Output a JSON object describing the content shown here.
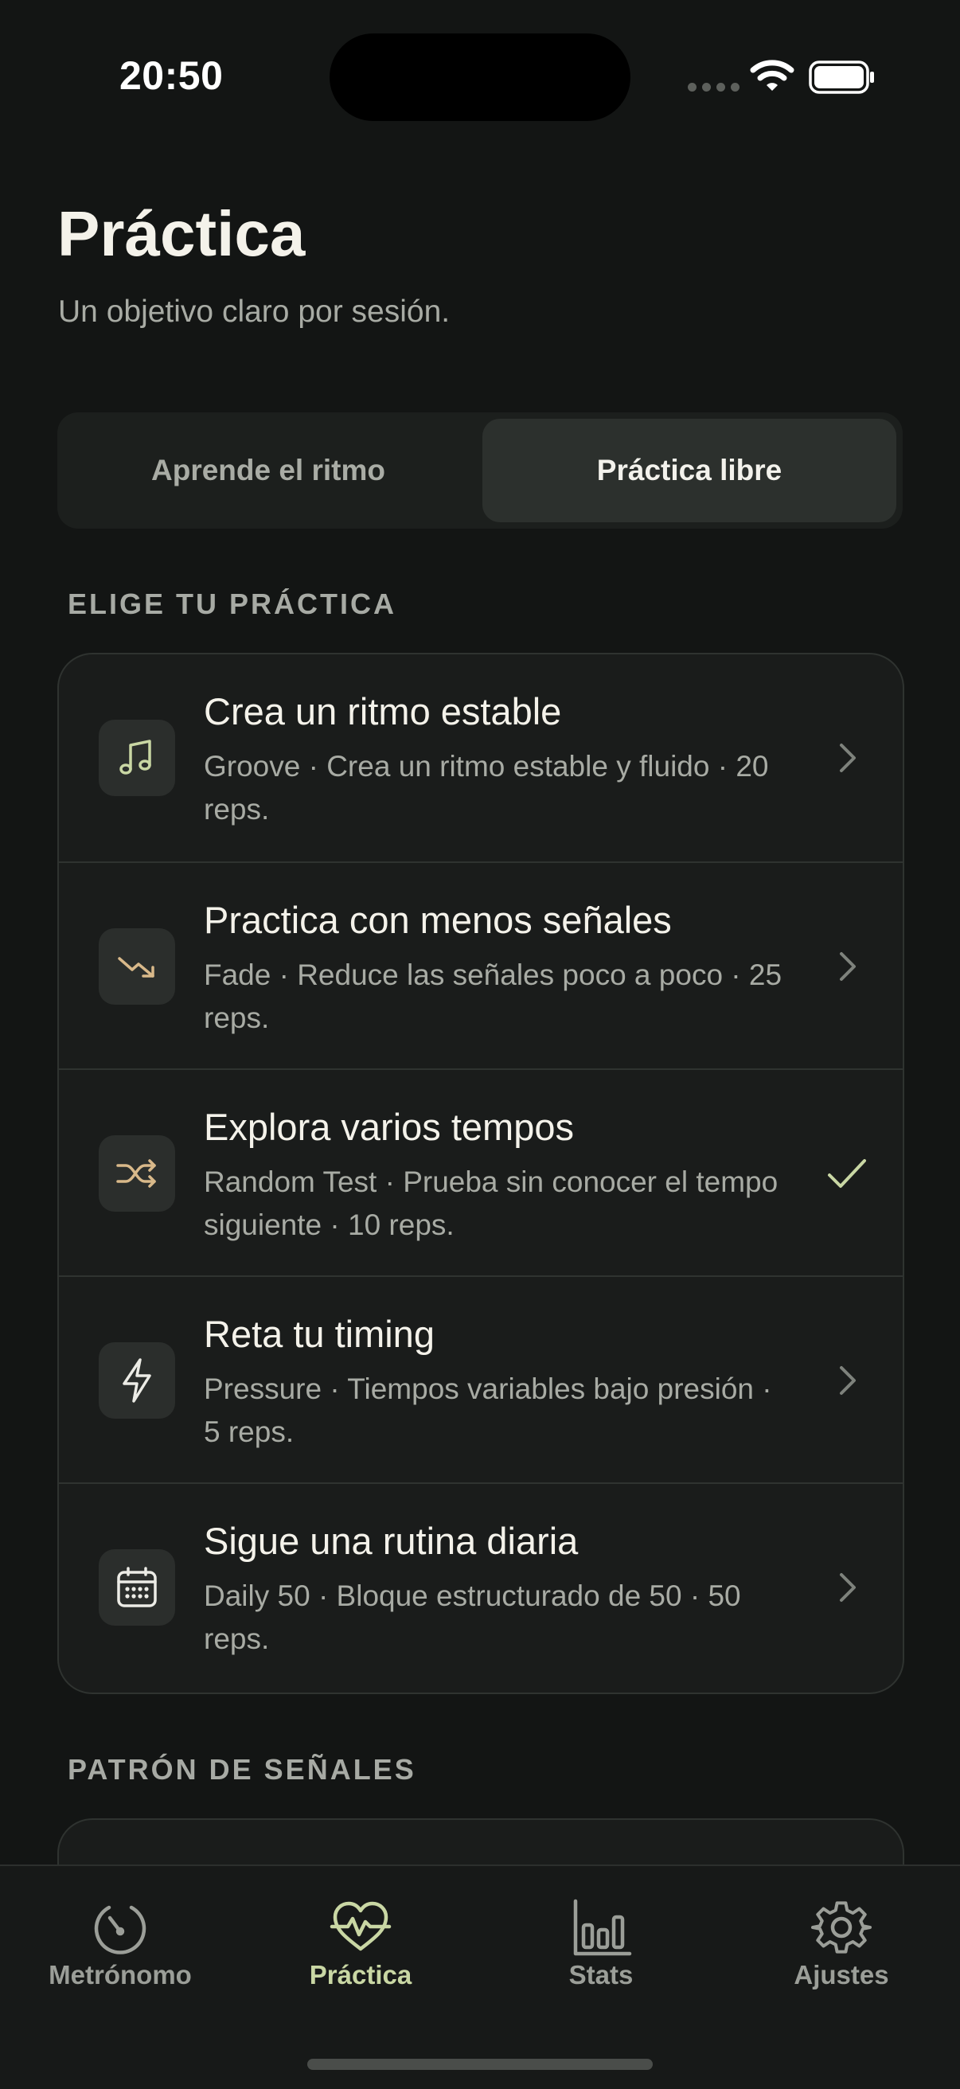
{
  "status_bar": {
    "time": "20:50"
  },
  "header": {
    "title": "Práctica",
    "subtitle": "Un objetivo claro por sesión."
  },
  "segmented": {
    "options": [
      "Aprende el ritmo",
      "Práctica libre"
    ],
    "selected": "Práctica libre"
  },
  "sections": {
    "choose": "ELIGE TU PRÁCTICA",
    "pattern": "PATRÓN DE SEÑALES"
  },
  "practices": [
    {
      "title": "Crea un ritmo estable",
      "desc": "Groove · Crea un ritmo estable y fluido · 20 reps.",
      "icon": "music-note-icon",
      "trailing": "chevron"
    },
    {
      "title": "Practica con menos señales",
      "desc": "Fade · Reduce las señales poco a poco · 25 reps.",
      "icon": "trend-down-icon",
      "trailing": "chevron"
    },
    {
      "title": "Explora varios tempos",
      "desc": "Random Test · Prueba sin conocer el tempo siguiente · 10 reps.",
      "icon": "shuffle-icon",
      "trailing": "check"
    },
    {
      "title": "Reta tu timing",
      "desc": "Pressure · Tiempos variables bajo presión · 5 reps.",
      "icon": "lightning-icon",
      "trailing": "chevron"
    },
    {
      "title": "Sigue una rutina diaria",
      "desc": "Daily 50 · Bloque estructurado de 50 · 50 reps.",
      "icon": "calendar-icon",
      "trailing": "chevron"
    }
  ],
  "tabs": [
    {
      "label": "Metrónomo",
      "icon": "metronome-gauge-icon"
    },
    {
      "label": "Práctica",
      "icon": "heartbeat-icon",
      "active": true
    },
    {
      "label": "Stats",
      "icon": "bar-chart-icon"
    },
    {
      "label": "Ajustes",
      "icon": "gear-icon"
    }
  ],
  "colors": {
    "background": "#131514",
    "accent": "#c9d7a4",
    "icon_warm": "#d9b98a"
  }
}
